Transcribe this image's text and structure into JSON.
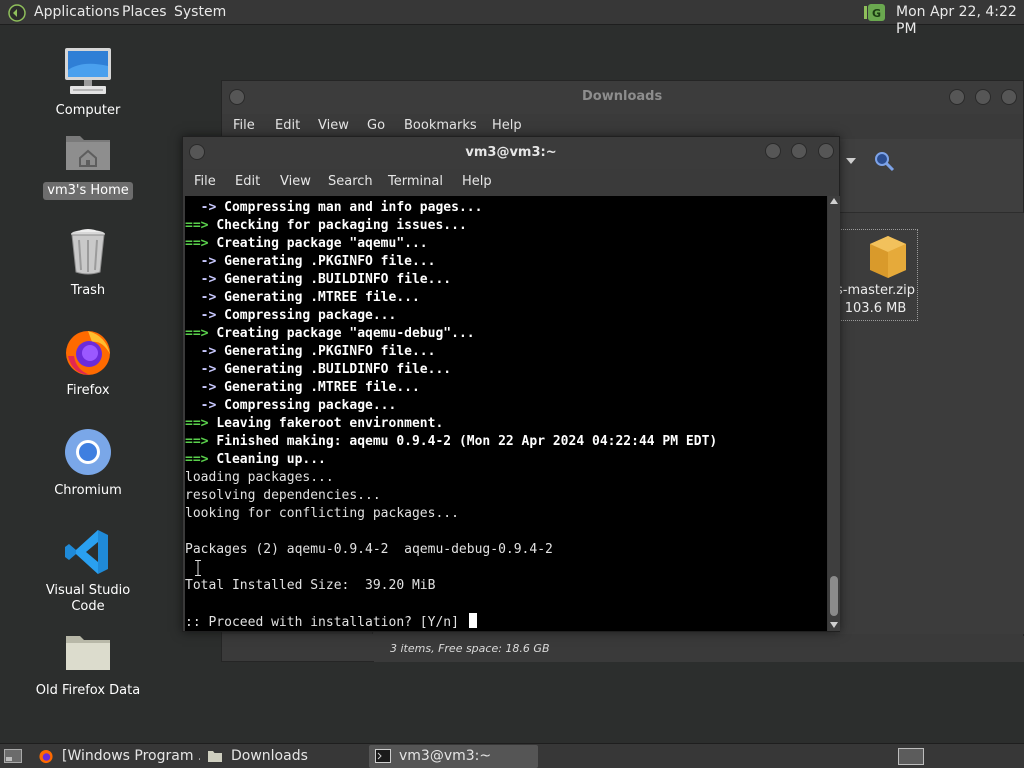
{
  "top_panel": {
    "menus": [
      "Applications",
      "Places",
      "System"
    ],
    "clock": "Mon Apr 22,  4:22 PM",
    "tray_icon": "update-notifier-icon"
  },
  "desktop": {
    "icons": [
      {
        "label": "Computer",
        "icon": "computer-icon",
        "selected": false
      },
      {
        "label": "vm3's Home",
        "icon": "home-folder-icon",
        "selected": true
      },
      {
        "label": "Trash",
        "icon": "trash-icon",
        "selected": false
      },
      {
        "label": "Firefox",
        "icon": "firefox-icon",
        "selected": false
      },
      {
        "label": "Chromium",
        "icon": "chromium-icon",
        "selected": false
      },
      {
        "label": "Visual Studio Code",
        "icon": "vscode-icon",
        "selected": false
      },
      {
        "label": "Old Firefox Data",
        "icon": "folder-icon",
        "selected": false
      }
    ]
  },
  "file_manager": {
    "title": "Downloads",
    "menu": [
      "File",
      "Edit",
      "View",
      "Go",
      "Bookmarks",
      "Help"
    ],
    "file": {
      "name": "s-master.zip",
      "size": "103.6 MB",
      "icon": "archive-icon"
    },
    "status": "3 items, Free space: 18.6 GB"
  },
  "terminal": {
    "title": "vm3@vm3:~",
    "menu": [
      "File",
      "Edit",
      "View",
      "Search",
      "Terminal",
      "Help"
    ],
    "lines": [
      {
        "prefix": "  -> ",
        "style": "blue",
        "text": "Compressing man and info pages..."
      },
      {
        "prefix": "==> ",
        "style": "arrow",
        "text": "Checking for packaging issues..."
      },
      {
        "prefix": "==> ",
        "style": "arrow",
        "text": "Creating package \"aqemu\"..."
      },
      {
        "prefix": "  -> ",
        "style": "blue",
        "text": "Generating .PKGINFO file..."
      },
      {
        "prefix": "  -> ",
        "style": "blue",
        "text": "Generating .BUILDINFO file..."
      },
      {
        "prefix": "  -> ",
        "style": "blue",
        "text": "Generating .MTREE file..."
      },
      {
        "prefix": "  -> ",
        "style": "blue",
        "text": "Compressing package..."
      },
      {
        "prefix": "==> ",
        "style": "arrow",
        "text": "Creating package \"aqemu-debug\"..."
      },
      {
        "prefix": "  -> ",
        "style": "blue",
        "text": "Generating .PKGINFO file..."
      },
      {
        "prefix": "  -> ",
        "style": "blue",
        "text": "Generating .BUILDINFO file..."
      },
      {
        "prefix": "  -> ",
        "style": "blue",
        "text": "Generating .MTREE file..."
      },
      {
        "prefix": "  -> ",
        "style": "blue",
        "text": "Compressing package..."
      },
      {
        "prefix": "==> ",
        "style": "arrow",
        "text": "Leaving fakeroot environment."
      },
      {
        "prefix": "==> ",
        "style": "arrow",
        "text": "Finished making: aqemu 0.9.4-2 (Mon 22 Apr 2024 04:22:44 PM EDT)"
      },
      {
        "prefix": "==> ",
        "style": "arrow",
        "text": "Cleaning up..."
      },
      {
        "prefix": "",
        "style": "plain",
        "text": "loading packages..."
      },
      {
        "prefix": "",
        "style": "plain",
        "text": "resolving dependencies..."
      },
      {
        "prefix": "",
        "style": "plain",
        "text": "looking for conflicting packages..."
      },
      {
        "prefix": "",
        "style": "plain",
        "text": ""
      },
      {
        "prefix": "",
        "style": "plain",
        "text": "Packages (2) aqemu-0.9.4-2  aqemu-debug-0.9.4-2"
      },
      {
        "prefix": "",
        "style": "plain",
        "text": ""
      },
      {
        "prefix": "",
        "style": "plain",
        "text": "Total Installed Size:  39.20 MiB"
      },
      {
        "prefix": "",
        "style": "plain",
        "text": ""
      },
      {
        "prefix": "",
        "style": "plain",
        "text": ":: Proceed with installation? [Y/n] ",
        "cursor": true
      }
    ]
  },
  "taskbar": {
    "tasks": [
      {
        "label": "[Windows Program ...",
        "icon": "firefox-icon",
        "active": false
      },
      {
        "label": "Downloads",
        "icon": "folder-icon",
        "active": false
      },
      {
        "label": "vm3@vm3:~",
        "icon": "terminal-icon",
        "active": true
      }
    ],
    "show_desktop_icon": "show-desktop-icon",
    "workspace_icon": "workspace-switcher-icon"
  },
  "colors": {
    "desktop_bg": "#2c2e2d",
    "panel_bg": "#373737",
    "terminal_bg": "#000000",
    "prompt_arrow_green": "#5ad14c"
  }
}
